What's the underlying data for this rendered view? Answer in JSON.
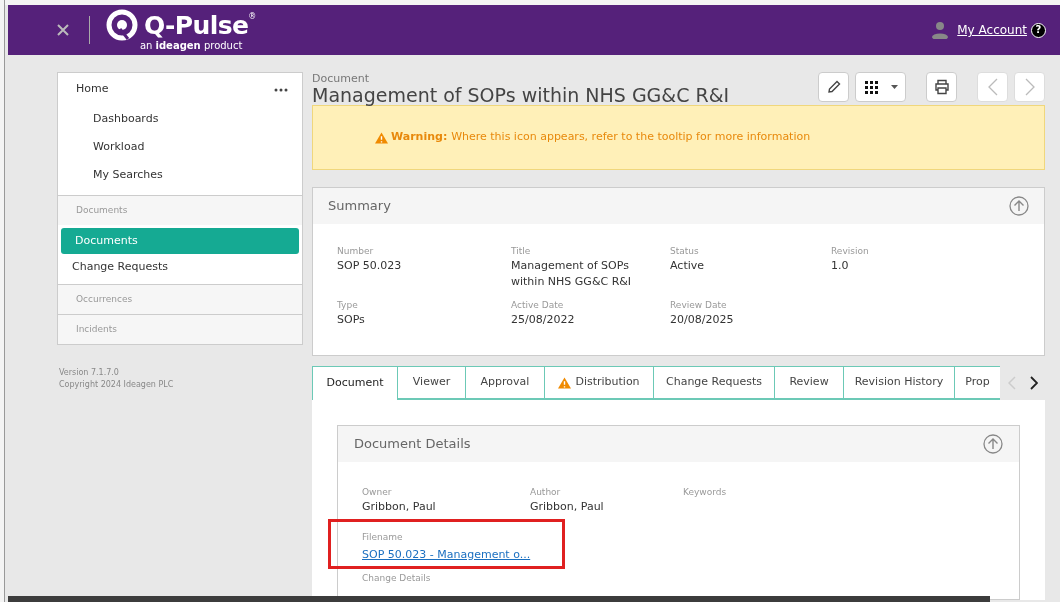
{
  "header": {
    "logo_name": "Q-Pulse",
    "logo_mark": "®",
    "tagline": "an **ideagen** product",
    "account_link": "My Account",
    "help_glyph": "?"
  },
  "sidebar": {
    "items": [
      {
        "kind": "home",
        "label": "Home",
        "selected": false
      },
      {
        "kind": "sub",
        "label": "Dashboards",
        "selected": false
      },
      {
        "kind": "sub",
        "label": "Workload",
        "selected": false
      },
      {
        "kind": "sub",
        "label": "My Searches",
        "selected": false
      },
      {
        "kind": "section",
        "label": "Documents",
        "selected": false
      },
      {
        "kind": "item",
        "label": "Documents",
        "selected": true
      },
      {
        "kind": "item",
        "label": "Change Requests",
        "selected": false
      },
      {
        "kind": "section",
        "label": "Occurrences",
        "selected": false
      },
      {
        "kind": "section",
        "label": "Incidents",
        "selected": false
      }
    ],
    "version": "Version 7.1.7.0",
    "copyright": "Copyright 2024 Ideagen PLC"
  },
  "document": {
    "kicker": "Document",
    "title": "Management of SOPs within NHS GG&C R&I"
  },
  "warning": {
    "label": "Warning:",
    "message": "Where this icon appears, refer to the tooltip for more information"
  },
  "summary": {
    "title": "Summary",
    "fields": [
      {
        "label": "Number",
        "value": "SOP 50.023"
      },
      {
        "label": "Title",
        "value": "Management of SOPs within NHS GG&C R&I"
      },
      {
        "label": "Status",
        "value": "Active"
      },
      {
        "label": "Revision",
        "value": "1.0"
      },
      {
        "label": "Type",
        "value": "SOPs"
      },
      {
        "label": "Active Date",
        "value": "25/08/2022"
      },
      {
        "label": "Review Date",
        "value": "20/08/2025"
      }
    ]
  },
  "tabs": [
    {
      "label": "Document",
      "selected": true,
      "warning": false
    },
    {
      "label": "Viewer",
      "selected": false,
      "warning": false
    },
    {
      "label": "Approval",
      "selected": false,
      "warning": false
    },
    {
      "label": "Distribution",
      "selected": false,
      "warning": true
    },
    {
      "label": "Change Requests",
      "selected": false,
      "warning": false
    },
    {
      "label": "Review",
      "selected": false,
      "warning": false
    },
    {
      "label": "Revision History",
      "selected": false,
      "warning": false
    },
    {
      "label": "Prop",
      "selected": false,
      "warning": false
    }
  ],
  "details": {
    "title": "Document Details",
    "fields": [
      {
        "label": "Owner",
        "value": "Gribbon, Paul"
      },
      {
        "label": "Author",
        "value": "Gribbon, Paul"
      },
      {
        "label": "Keywords"
      }
    ],
    "filename_label": "Filename",
    "filename_link": "SOP 50.023 - Management o...",
    "filename_highlighted": true,
    "next_label": "Change Details"
  }
}
